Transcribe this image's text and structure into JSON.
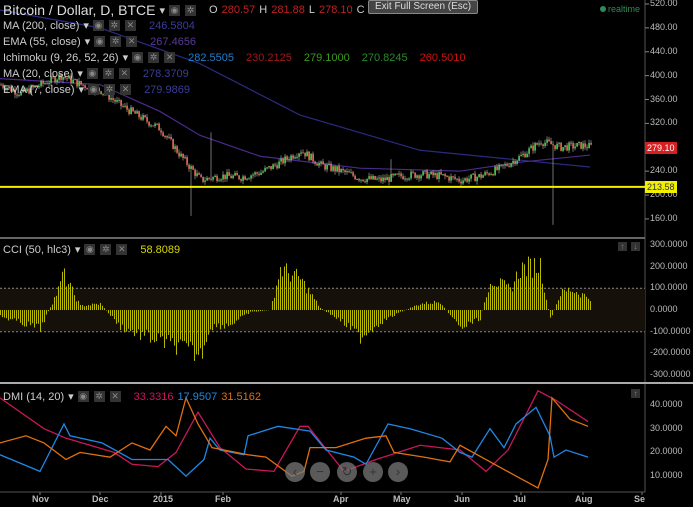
{
  "header": {
    "title": "Bitcoin / Dollar, D, BTCE",
    "o_label": "O",
    "o": "280.57",
    "h_label": "H",
    "h": "281.88",
    "l_label": "L",
    "l": "278.10",
    "c_label": "C",
    "c": "279.10",
    "tooltip": "Exit Full Screen (Esc)",
    "realtime": "realtime"
  },
  "indicators": [
    {
      "name": "MA (200, close)",
      "values": [
        "246.5804"
      ],
      "colors": [
        "#3b3b9a"
      ]
    },
    {
      "name": "EMA (55, close)",
      "values": [
        "267.4656"
      ],
      "colors": [
        "#5a3a9a"
      ]
    },
    {
      "name": "Ichimoku (9, 26, 52, 26)",
      "values": [
        "282.5505",
        "230.2125",
        "279.1000",
        "270.8245",
        "260.5010"
      ],
      "colors": [
        "#1e7fd0",
        "#a01818",
        "#3c9a1a",
        "#2a8a2a",
        "#d01010"
      ]
    },
    {
      "name": "MA (20, close)",
      "values": [
        "278.3709"
      ],
      "colors": [
        "#3b3b9a"
      ]
    },
    {
      "name": "EMA (7, close)",
      "values": [
        "279.9869"
      ],
      "colors": [
        "#3b3b9a"
      ]
    }
  ],
  "price_axis": [
    "520.00",
    "480.00",
    "440.00",
    "400.00",
    "360.00",
    "320.00",
    "240.00",
    "200.00",
    "160.00"
  ],
  "last_price": {
    "value": "279.10",
    "color": "#d42020"
  },
  "hline": {
    "value": "213.58",
    "color": "#f0f000"
  },
  "cci": {
    "name": "CCI (50, hlc3)",
    "value": "58.8089",
    "axis": [
      "300.0000",
      "200.0000",
      "100.0000",
      "0.0000",
      "-100.0000",
      "-200.0000",
      "-300.0000"
    ]
  },
  "dmi": {
    "name": "DMI (14, 20)",
    "axis": [
      "40.0000",
      "30.0000",
      "20.0000",
      "10.0000"
    ]
  },
  "time_axis": [
    "Nov",
    "Dec",
    "2015",
    "Feb",
    "Apr",
    "May",
    "Jun",
    "Jul",
    "Aug",
    "Se"
  ],
  "nav_buttons": [
    "‹",
    "−",
    "↻",
    "+",
    "›"
  ],
  "chart_data": [
    {
      "type": "candlestick",
      "title": "Bitcoin / Dollar, D, BTCE",
      "ylim": [
        140,
        525
      ],
      "day_step": 10,
      "closes": [
        385,
        370,
        385,
        400,
        385,
        375,
        350,
        330,
        310,
        265,
        225,
        232,
        230,
        238,
        255,
        275,
        250,
        240,
        228,
        225,
        232,
        235,
        232,
        225,
        232,
        245,
        265,
        290,
        280,
        283,
        279
      ],
      "wicks": [
        {
          "day": 95,
          "low": 165
        },
        {
          "day": 105,
          "high": 305
        },
        {
          "day": 195,
          "high": 260
        },
        {
          "day": 276,
          "low": 150
        }
      ],
      "ma200": [
        [
          0,
          510
        ],
        [
          50,
          480
        ],
        [
          100,
          420
        ],
        [
          150,
          334
        ],
        [
          210,
          275
        ],
        [
          295,
          247
        ]
      ],
      "ema55": [
        [
          0,
          395
        ],
        [
          50,
          385
        ],
        [
          80,
          340
        ],
        [
          100,
          300
        ],
        [
          130,
          265
        ],
        [
          180,
          245
        ],
        [
          230,
          240
        ],
        [
          260,
          255
        ],
        [
          295,
          267
        ]
      ],
      "hline": 213.58
    },
    {
      "type": "bar",
      "title": "CCI (50, hlc3)",
      "ylim": [
        -300,
        300
      ],
      "band": [
        -100,
        100
      ],
      "points": [
        [
          0,
          -30
        ],
        [
          10,
          -60
        ],
        [
          20,
          -90
        ],
        [
          30,
          120
        ],
        [
          31,
          180
        ],
        [
          40,
          20
        ],
        [
          50,
          30
        ],
        [
          60,
          -80
        ],
        [
          70,
          -120
        ],
        [
          80,
          -150
        ],
        [
          90,
          -180
        ],
        [
          100,
          -220
        ],
        [
          105,
          -80
        ],
        [
          115,
          -70
        ],
        [
          125,
          -10
        ],
        [
          135,
          0
        ],
        [
          140,
          200
        ],
        [
          150,
          150
        ],
        [
          160,
          10
        ],
        [
          170,
          -50
        ],
        [
          180,
          -130
        ],
        [
          190,
          -60
        ],
        [
          200,
          -10
        ],
        [
          210,
          30
        ],
        [
          220,
          40
        ],
        [
          230,
          -90
        ],
        [
          240,
          -40
        ],
        [
          245,
          150
        ],
        [
          255,
          100
        ],
        [
          260,
          200
        ],
        [
          270,
          220
        ],
        [
          275,
          -50
        ],
        [
          280,
          80
        ],
        [
          285,
          100
        ],
        [
          295,
          58
        ]
      ]
    },
    {
      "type": "line",
      "title": "DMI (14, 20)",
      "ylim": [
        3,
        47
      ],
      "series": [
        {
          "label": "33.3316",
          "color": "#c8175a",
          "points": [
            [
              0,
              43
            ],
            [
              22,
              30
            ],
            [
              33,
              26
            ],
            [
              57,
              20
            ],
            [
              66,
              15
            ],
            [
              79,
              14
            ],
            [
              88,
              20
            ],
            [
              99,
              37
            ],
            [
              110,
              22
            ],
            [
              123,
              13
            ],
            [
              137,
              12
            ],
            [
              150,
              31
            ],
            [
              154,
              31
            ],
            [
              172,
              12
            ],
            [
              188,
              17
            ],
            [
              210,
              23
            ],
            [
              230,
              21
            ],
            [
              243,
              12
            ],
            [
              254,
              21
            ],
            [
              269,
              46
            ],
            [
              278,
              42
            ],
            [
              294,
              33
            ]
          ]
        },
        {
          "label": "17.9507",
          "color": "#1e88e5",
          "points": [
            [
              0,
              19
            ],
            [
              20,
              12
            ],
            [
              32,
              32
            ],
            [
              35,
              27
            ],
            [
              51,
              24
            ],
            [
              66,
              17
            ],
            [
              84,
              17
            ],
            [
              93,
              10
            ],
            [
              102,
              17
            ],
            [
              105,
              26
            ],
            [
              110,
              21
            ],
            [
              122,
              19
            ],
            [
              124,
              27
            ],
            [
              139,
              31
            ],
            [
              155,
              29
            ],
            [
              163,
              21
            ],
            [
              177,
              18
            ],
            [
              183,
              15
            ],
            [
              194,
              32
            ],
            [
              205,
              30
            ],
            [
              221,
              26
            ],
            [
              230,
              20
            ],
            [
              236,
              18
            ],
            [
              245,
              30
            ],
            [
              252,
              22
            ],
            [
              258,
              32
            ],
            [
              268,
              39
            ],
            [
              275,
              27
            ],
            [
              277,
              18
            ],
            [
              283,
              21
            ],
            [
              294,
              18
            ]
          ]
        },
        {
          "label": "31.5162",
          "color": "#e07010",
          "points": [
            [
              0,
              24
            ],
            [
              13,
              27
            ],
            [
              22,
              24
            ],
            [
              33,
              17
            ],
            [
              40,
              20
            ],
            [
              55,
              18
            ],
            [
              66,
              24
            ],
            [
              75,
              21
            ],
            [
              83,
              31
            ],
            [
              88,
              27
            ],
            [
              93,
              43
            ],
            [
              99,
              32
            ],
            [
              106,
              22
            ],
            [
              124,
              19
            ],
            [
              133,
              18
            ],
            [
              146,
              10
            ],
            [
              152,
              12
            ],
            [
              155,
              22
            ],
            [
              168,
              22
            ],
            [
              183,
              26
            ],
            [
              193,
              27
            ],
            [
              197,
              20
            ],
            [
              212,
              18
            ],
            [
              225,
              16
            ],
            [
              230,
              23
            ],
            [
              243,
              17
            ],
            [
              258,
              10
            ],
            [
              269,
              5
            ],
            [
              274,
              17
            ],
            [
              276,
              43
            ],
            [
              285,
              34
            ],
            [
              294,
              31
            ]
          ]
        }
      ]
    }
  ]
}
